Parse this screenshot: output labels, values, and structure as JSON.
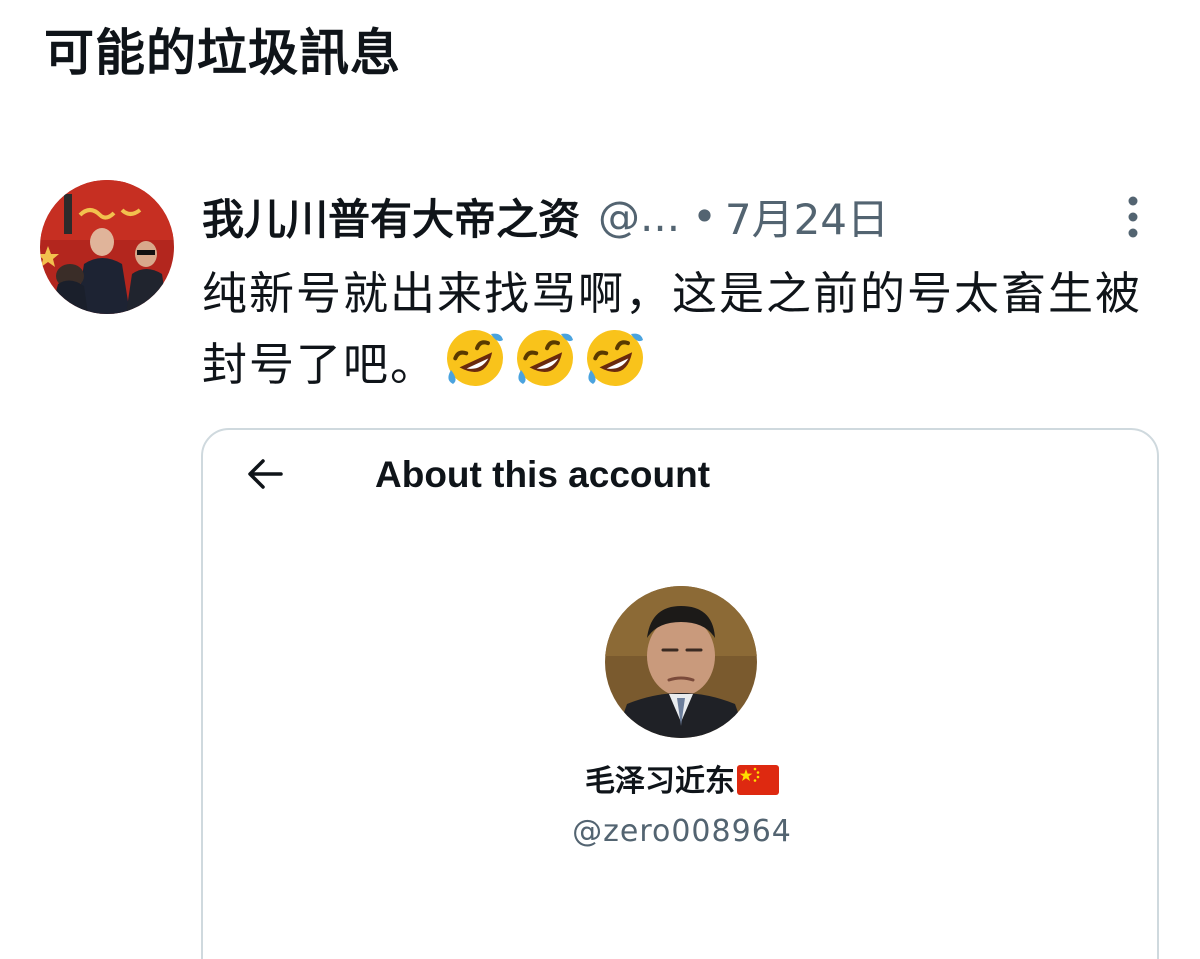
{
  "page": {
    "section_title": "可能的垃圾訊息"
  },
  "tweet": {
    "author_name": "我儿川普有大帝之资",
    "author_handle": "@...",
    "separator": "•",
    "date": "7月24日",
    "text": "纯新号就出来找骂啊，这是之前的号太畜生被封号了吧。",
    "emojis": [
      "rolling-on-floor-laughing-emoji",
      "rolling-on-floor-laughing-emoji",
      "rolling-on-floor-laughing-emoji"
    ],
    "avatar_icon": "user-avatar-photo",
    "more_icon": "more-vertical-icon"
  },
  "embedded_card": {
    "back_icon": "arrow-left-icon",
    "title": "About this account",
    "account_name": "毛泽习近东",
    "account_flag": "china-flag-emoji",
    "account_handle": "@zero008964",
    "avatar_icon": "account-avatar-photo"
  },
  "colors": {
    "text_primary": "#0f1419",
    "text_secondary": "#536471",
    "card_border": "#cfd9de",
    "flag_red": "#de2910",
    "flag_yellow": "#ffde00"
  }
}
